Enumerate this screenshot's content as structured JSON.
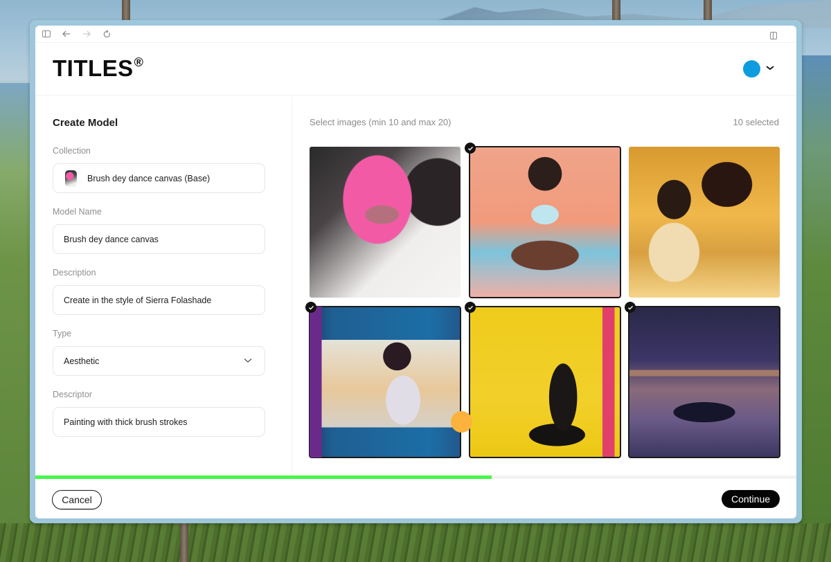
{
  "browser": {
    "icons": [
      "sidebar-toggle-icon",
      "back-arrow-icon",
      "forward-arrow-icon",
      "reload-icon",
      "split-view-icon"
    ]
  },
  "header": {
    "logo": "TITLES",
    "logo_mark": "®",
    "avatar_color": "#0e9cdf"
  },
  "form": {
    "title": "Create Model",
    "collection": {
      "label": "Collection",
      "value": "Brush dey dance canvas (Base)"
    },
    "model_name": {
      "label": "Model Name",
      "value": "Brush dey dance canvas"
    },
    "description": {
      "label": "Description",
      "value": "Create in the style of Sierra Folashade"
    },
    "type": {
      "label": "Type",
      "value": "Aesthetic"
    },
    "descriptor": {
      "label": "Descriptor",
      "value": "Painting with thick brush strokes"
    }
  },
  "gallery": {
    "hint": "Select images (min 10 and max 20)",
    "selected_count": "10 selected",
    "images": [
      {
        "subject": "pink and black painted portrait of a woman's face",
        "selected": false
      },
      {
        "subject": "woman sitting cross-legged in pastel colors",
        "selected": true
      },
      {
        "subject": "couple at a table in warm golden light",
        "selected": false
      },
      {
        "subject": "woman looking through a window at a car",
        "selected": true
      },
      {
        "subject": "man seated against a yellow background",
        "selected": true
      },
      {
        "subject": "car on a rainy neon city street at night",
        "selected": true
      }
    ]
  },
  "progress": {
    "percent": 60,
    "color": "#45f64a"
  },
  "footer": {
    "cancel_label": "Cancel",
    "continue_label": "Continue"
  }
}
